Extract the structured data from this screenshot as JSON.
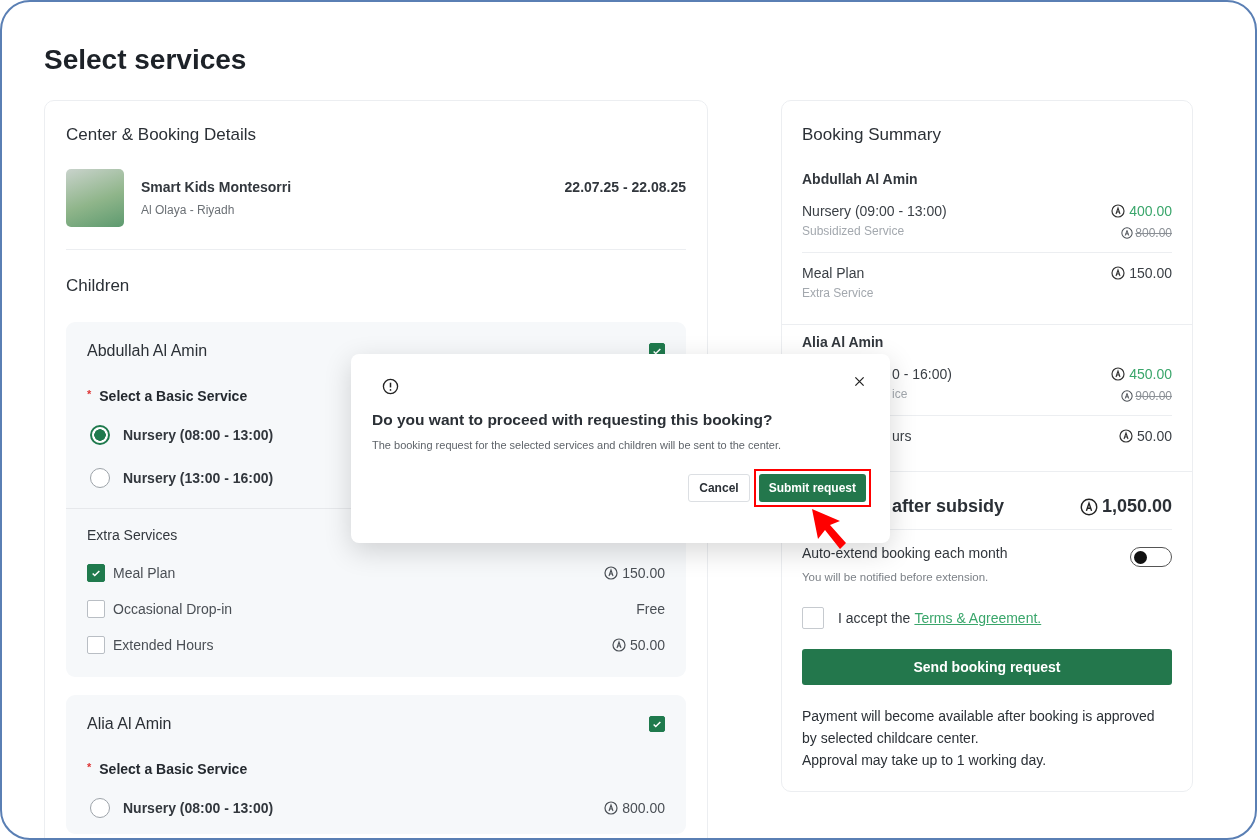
{
  "page_title": "Select services",
  "details": {
    "title": "Center & Booking Details",
    "center_name": "Smart Kids Montesorri",
    "location": "Al Olaya - Riyadh",
    "dates": "22.07.25 - 22.08.25"
  },
  "children_title": "Children",
  "children": [
    {
      "name": "Abdullah Al Amin",
      "checked": true,
      "required_mark": "*",
      "basic_label": "Select a Basic Service",
      "options": [
        {
          "label": "Nursery (08:00 - 13:00)",
          "selected": true
        },
        {
          "label": "Nursery (13:00 - 16:00)",
          "selected": false
        }
      ],
      "extras_title": "Extra Services",
      "extras": [
        {
          "label": "Meal Plan",
          "checked": true,
          "price": "150.00",
          "kind": "paid"
        },
        {
          "label": "Occasional Drop-in",
          "checked": false,
          "price": "Free",
          "kind": "free"
        },
        {
          "label": "Extended Hours",
          "checked": false,
          "price": "50.00",
          "kind": "paid"
        }
      ]
    },
    {
      "name": "Alia Al Amin",
      "checked": true,
      "required_mark": "*",
      "basic_label": "Select a Basic Service",
      "options": [
        {
          "label": "Nursery (08:00 - 13:00)",
          "selected": false,
          "price": "800.00"
        }
      ]
    }
  ],
  "summary": {
    "title": "Booking Summary",
    "groups": [
      {
        "name": "Abdullah Al Amin",
        "items": [
          {
            "kind": "full",
            "label": "Nursery (09:00 - 13:00)",
            "note": "Subsidized Service",
            "price": "400.00",
            "old_price": "800.00"
          },
          {
            "kind": "full",
            "label": "Meal Plan",
            "note": "Extra Service",
            "price": "150.00"
          }
        ]
      },
      {
        "name": "Alia Al Amin",
        "items": [
          {
            "kind": "partial",
            "label": "0 - 16:00)",
            "note": "ice",
            "price": "450.00",
            "old_price": "900.00"
          },
          {
            "kind": "partial",
            "label": "urs",
            "price": "50.00"
          }
        ]
      }
    ],
    "total": {
      "kind": "partial",
      "label": "after subsidy",
      "amount": "1,050.00"
    },
    "auto_extend": {
      "label": "Auto-extend booking each month",
      "hint": "You will be notified before extension.",
      "on": false
    },
    "terms": {
      "checked": false,
      "text": "I accept the",
      "link": "Terms & Agreement."
    },
    "send_button": "Send booking request",
    "footnotes": [
      "Payment will become available after booking is approved by selected childcare center.",
      "Approval may take up to 1 working day."
    ]
  },
  "modal": {
    "title": "Do you want to proceed with requesting this booking?",
    "message": "The booking request for the selected services and children will be sent to the center.",
    "buttons": [
      {
        "label": "Cancel",
        "kind": "secondary",
        "highlighted": false
      },
      {
        "label": "Submit request",
        "kind": "primary",
        "highlighted": true
      }
    ]
  }
}
